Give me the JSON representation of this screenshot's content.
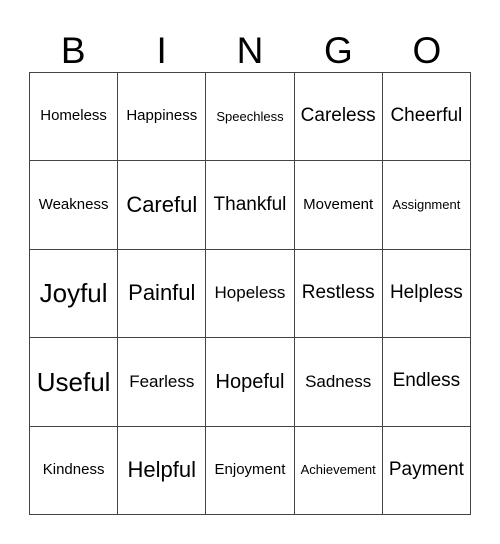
{
  "header": [
    "B",
    "I",
    "N",
    "G",
    "O"
  ],
  "rows": [
    [
      "Homeless",
      "Happiness",
      "Speechless",
      "Careless",
      "Cheerful"
    ],
    [
      "Weakness",
      "Careful",
      "Thankful",
      "Movement",
      "Assignment"
    ],
    [
      "Joyful",
      "Painful",
      "Hopeless",
      "Restless",
      "Helpless"
    ],
    [
      "Useful",
      "Fearless",
      "Hopeful",
      "Sadness",
      "Endless"
    ],
    [
      "Kindness",
      "Helpful",
      "Enjoyment",
      "Achievement",
      "Payment"
    ]
  ]
}
